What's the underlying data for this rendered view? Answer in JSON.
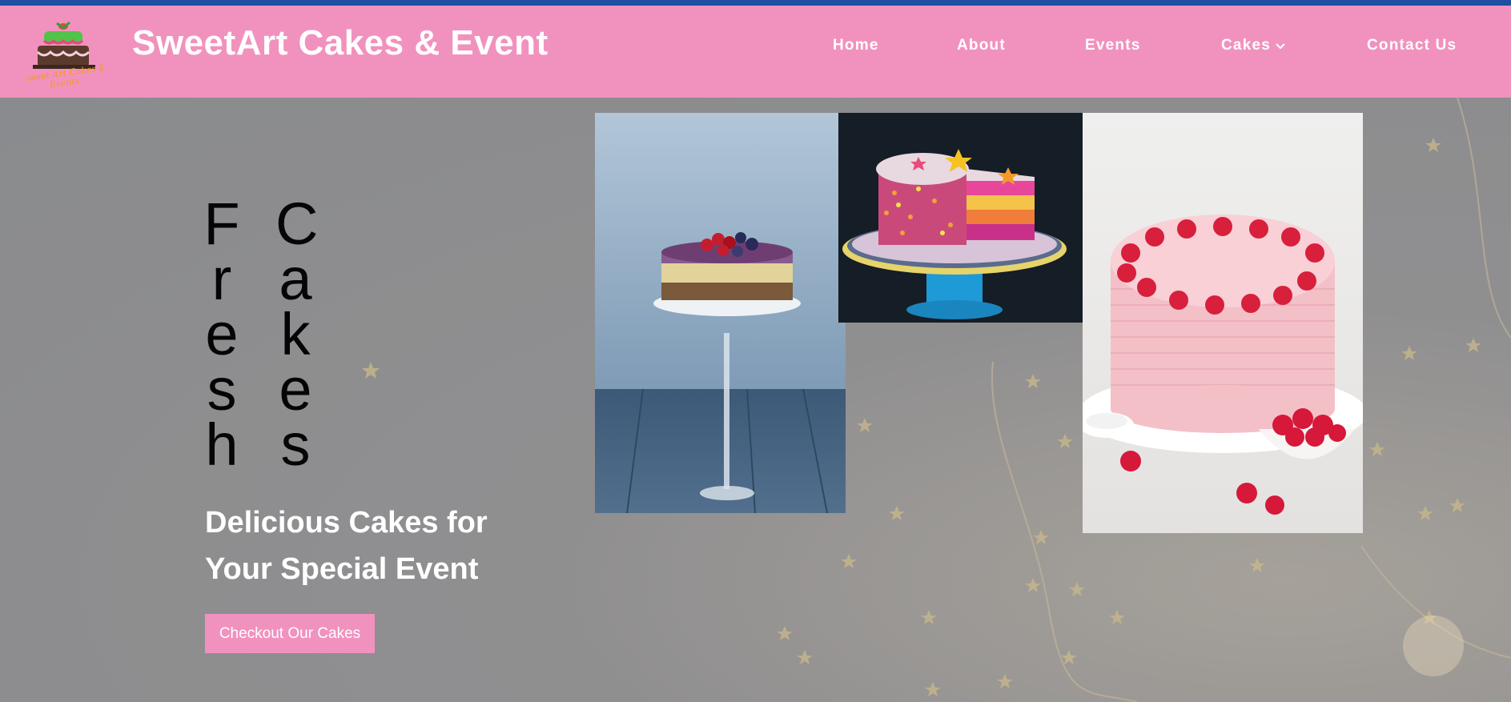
{
  "brand": {
    "title": "SweetArt Cakes & Event",
    "logo_icon": "cake-logo-icon"
  },
  "nav": {
    "items": [
      {
        "label": "Home"
      },
      {
        "label": "About"
      },
      {
        "label": "Events"
      },
      {
        "label": "Cakes",
        "icon": "chevron-down-icon"
      },
      {
        "label": "Contact Us"
      }
    ]
  },
  "hero": {
    "headline_word1": [
      "F",
      "r",
      "e",
      "s",
      "h"
    ],
    "headline_word2": [
      "C",
      "a",
      "k",
      "e",
      "s"
    ],
    "tagline_line1": "Delicious Cakes for",
    "tagline_line2": "Your Special Event",
    "cta_label": "Checkout Our Cakes",
    "photos": [
      "berry-cheesecake-on-glass-stand",
      "confetti-layer-cake-slice",
      "pink-raspberry-cake"
    ]
  },
  "colors": {
    "top_stripe": "#1f4fa0",
    "navbar": "#f192be",
    "hero_bg": "#8c8d90",
    "button": "#f192be",
    "text_light": "#ffffff",
    "headline": "#050505"
  }
}
